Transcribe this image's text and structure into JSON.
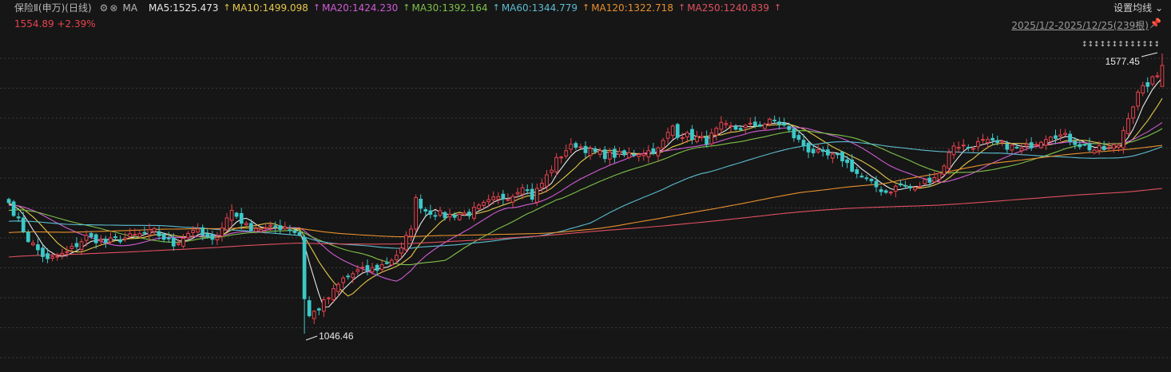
{
  "header": {
    "title": "保险Ⅱ(申万)(日线)",
    "ma_label": "MA",
    "gear_icon": "gear-icon",
    "close_icon": "close-circle-icon",
    "up_arrow": "↑",
    "mas": [
      {
        "label": "MA5:1525.473",
        "color": "#e8e8e8"
      },
      {
        "label": "MA10:1499.098",
        "color": "#e6c84a"
      },
      {
        "label": "MA20:1424.230",
        "color": "#d05cd6"
      },
      {
        "label": "MA30:1392.164",
        "color": "#7ec24a"
      },
      {
        "label": "MA60:1344.779",
        "color": "#5cbcd0"
      },
      {
        "label": "MA120:1322.718",
        "color": "#e8902e"
      },
      {
        "label": "MA250:1240.839",
        "color": "#e05060"
      }
    ],
    "settings_label": "设置均线",
    "settings_chevron": "⌄"
  },
  "price_line": {
    "price": "1554.89",
    "change": "+2.39%",
    "color": "#e8424e"
  },
  "range_text": "2025/1/2-2025/12/25(239根)",
  "pin_icon": "pin-icon",
  "marker_text": "↕↕↕↕↕↕↕↕↕↕↕↕↕",
  "chart_data": {
    "type": "candlestick",
    "date_range": [
      "2025/1/2",
      "2025/12/25"
    ],
    "bar_count": 239,
    "ylim": [
      1000,
      1600
    ],
    "grid": "horizontal-dotted",
    "up_color": "#e8424e",
    "down_color": "#3cc8c8",
    "high_annotation": {
      "value": 1577.45,
      "label": "1577.45"
    },
    "low_annotation": {
      "value": 1046.46,
      "label": "1046.46"
    },
    "last_close": 1554.89,
    "close_anchors": [
      [
        0,
        1295
      ],
      [
        4,
        1225
      ],
      [
        8,
        1185
      ],
      [
        12,
        1200
      ],
      [
        16,
        1230
      ],
      [
        20,
        1220
      ],
      [
        25,
        1230
      ],
      [
        30,
        1240
      ],
      [
        34,
        1215
      ],
      [
        38,
        1245
      ],
      [
        42,
        1220
      ],
      [
        46,
        1280
      ],
      [
        49,
        1250
      ],
      [
        53,
        1245
      ],
      [
        57,
        1250
      ],
      [
        60,
        1235
      ],
      [
        61,
        1115
      ],
      [
        62,
        1080
      ],
      [
        64,
        1095
      ],
      [
        66,
        1115
      ],
      [
        69,
        1150
      ],
      [
        72,
        1165
      ],
      [
        76,
        1170
      ],
      [
        79,
        1188
      ],
      [
        81,
        1205
      ],
      [
        83,
        1250
      ],
      [
        84,
        1300
      ],
      [
        86,
        1280
      ],
      [
        90,
        1270
      ],
      [
        95,
        1275
      ],
      [
        100,
        1300
      ],
      [
        104,
        1310
      ],
      [
        106,
        1330
      ],
      [
        108,
        1305
      ],
      [
        111,
        1345
      ],
      [
        113,
        1375
      ],
      [
        115,
        1395
      ],
      [
        117,
        1405
      ],
      [
        120,
        1392
      ],
      [
        123,
        1385
      ],
      [
        127,
        1385
      ],
      [
        130,
        1390
      ],
      [
        134,
        1395
      ],
      [
        137,
        1440
      ],
      [
        138,
        1425
      ],
      [
        141,
        1420
      ],
      [
        144,
        1412
      ],
      [
        147,
        1440
      ],
      [
        150,
        1435
      ],
      [
        153,
        1440
      ],
      [
        156,
        1445
      ],
      [
        158,
        1450
      ],
      [
        160,
        1440
      ],
      [
        162,
        1420
      ],
      [
        165,
        1395
      ],
      [
        168,
        1385
      ],
      [
        172,
        1378
      ],
      [
        175,
        1350
      ],
      [
        178,
        1330
      ],
      [
        181,
        1315
      ],
      [
        184,
        1328
      ],
      [
        187,
        1320
      ],
      [
        189,
        1335
      ],
      [
        192,
        1350
      ],
      [
        195,
        1405
      ],
      [
        198,
        1400
      ],
      [
        201,
        1410
      ],
      [
        205,
        1405
      ],
      [
        209,
        1395
      ],
      [
        212,
        1410
      ],
      [
        215,
        1425
      ],
      [
        218,
        1420
      ],
      [
        221,
        1405
      ],
      [
        224,
        1395
      ],
      [
        227,
        1397
      ],
      [
        229,
        1405
      ],
      [
        231,
        1460
      ],
      [
        233,
        1500
      ],
      [
        235,
        1520
      ],
      [
        237,
        1535
      ],
      [
        238,
        1554.89
      ]
    ],
    "ma_series": [
      {
        "name": "MA5",
        "period": 5,
        "value": 1525.473,
        "color": "#e8e8e8"
      },
      {
        "name": "MA10",
        "period": 10,
        "value": 1499.098,
        "color": "#e6c84a"
      },
      {
        "name": "MA20",
        "period": 20,
        "value": 1424.23,
        "color": "#d05cd6"
      },
      {
        "name": "MA30",
        "period": 30,
        "value": 1392.164,
        "color": "#7ec24a"
      },
      {
        "name": "MA60",
        "period": 60,
        "value": 1344.779,
        "color": "#5cbcd0"
      },
      {
        "name": "MA120",
        "period": 120,
        "value": 1322.718,
        "color": "#e8902e"
      },
      {
        "name": "MA250",
        "period": 250,
        "value": 1240.839,
        "color": "#e05060"
      }
    ]
  }
}
